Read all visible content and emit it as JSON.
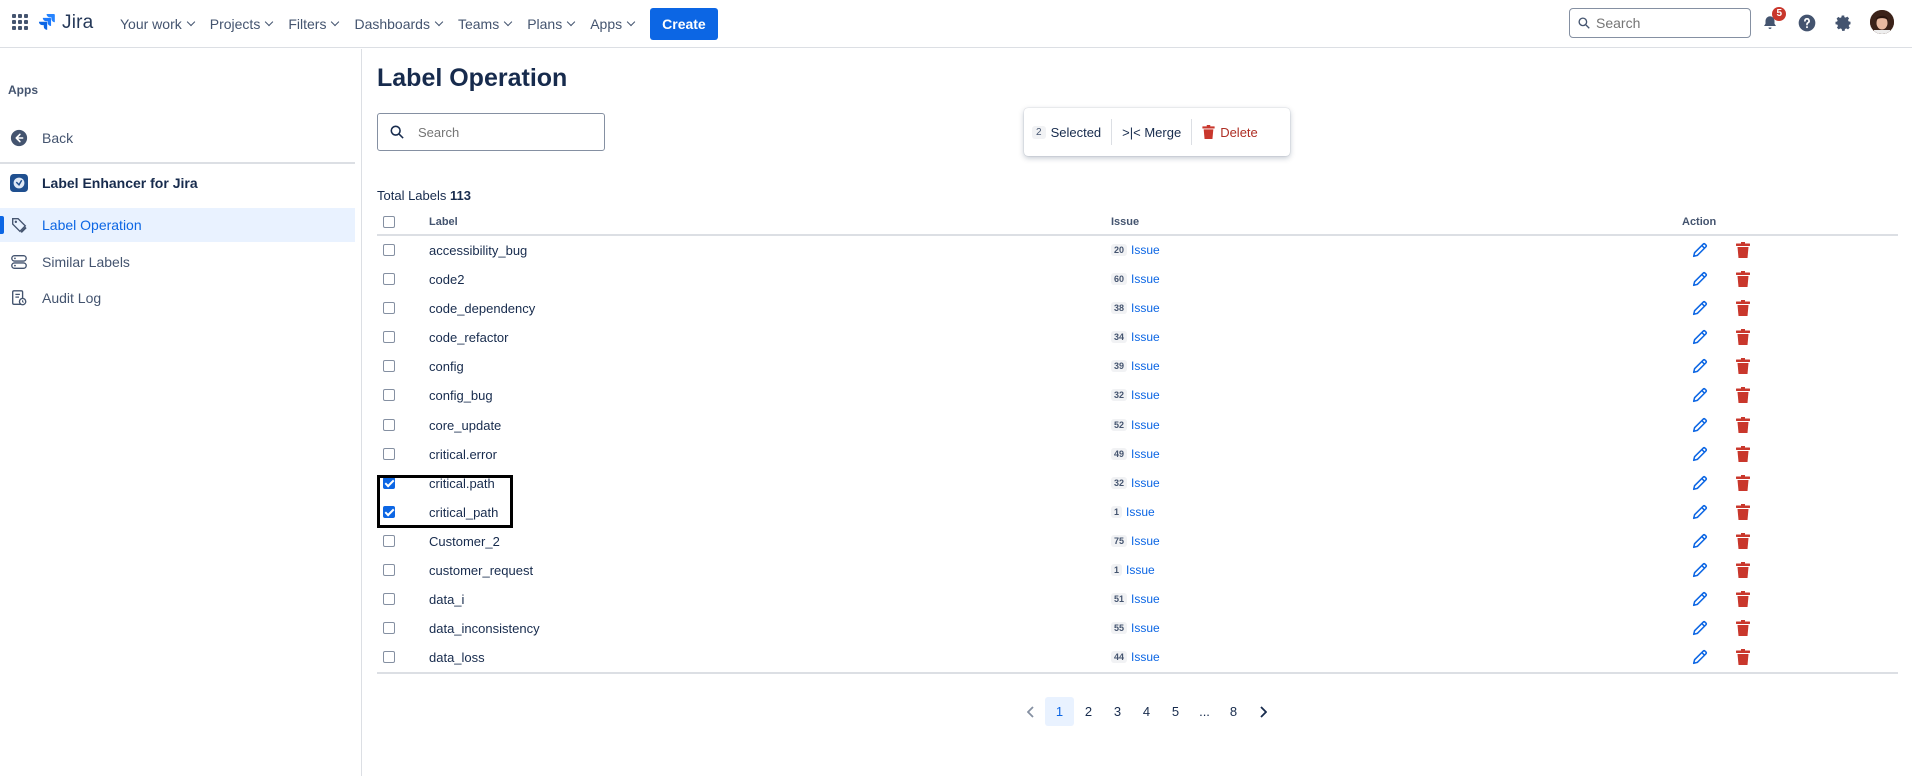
{
  "topnav": {
    "brand": "Jira",
    "items": [
      "Your work",
      "Projects",
      "Filters",
      "Dashboards",
      "Teams",
      "Plans",
      "Apps"
    ],
    "create_label": "Create",
    "search_placeholder": "Search",
    "notifications_count": "5"
  },
  "sidebar": {
    "heading": "Apps",
    "back_label": "Back",
    "app_name": "Label Enhancer for Jira",
    "items": [
      {
        "label": "Label Operation",
        "active": true
      },
      {
        "label": "Similar Labels",
        "active": false
      },
      {
        "label": "Audit Log",
        "active": false
      }
    ]
  },
  "main": {
    "title": "Label Operation",
    "search_placeholder": "Search",
    "toolbar": {
      "selected_count": "2",
      "selected_label": "Selected",
      "merge_label": ">|< Merge",
      "delete_label": "Delete"
    },
    "total_label": "Total Labels",
    "total_value": "113",
    "columns": {
      "label": "Label",
      "issue": "Issue",
      "action": "Action"
    },
    "issue_word": "Issue",
    "rows": [
      {
        "label": "accessibility_bug",
        "count": "20",
        "checked": false
      },
      {
        "label": "code2",
        "count": "60",
        "checked": false
      },
      {
        "label": "code_dependency",
        "count": "38",
        "checked": false
      },
      {
        "label": "code_refactor",
        "count": "34",
        "checked": false
      },
      {
        "label": "config",
        "count": "39",
        "checked": false
      },
      {
        "label": "config_bug",
        "count": "32",
        "checked": false
      },
      {
        "label": "core_update",
        "count": "52",
        "checked": false
      },
      {
        "label": "critical.error",
        "count": "49",
        "checked": false
      },
      {
        "label": "critical.path",
        "count": "32",
        "checked": true
      },
      {
        "label": "critical_path",
        "count": "1",
        "checked": true
      },
      {
        "label": "Customer_2",
        "count": "75",
        "checked": false
      },
      {
        "label": "customer_request",
        "count": "1",
        "checked": false
      },
      {
        "label": "data_i",
        "count": "51",
        "checked": false
      },
      {
        "label": "data_inconsistency",
        "count": "55",
        "checked": false
      },
      {
        "label": "data_loss",
        "count": "44",
        "checked": false
      }
    ],
    "pagination": {
      "pages": [
        "1",
        "2",
        "3",
        "4",
        "5",
        "...",
        "8"
      ],
      "current": "1"
    }
  },
  "colors": {
    "accent": "#0c66e4",
    "danger": "#ae2e24",
    "delete_icon": "#c9372c"
  }
}
